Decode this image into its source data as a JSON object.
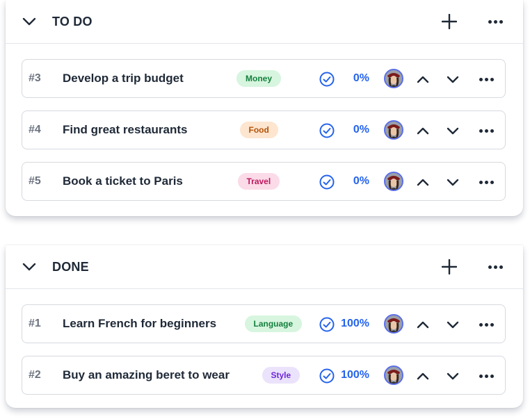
{
  "todo_group": {
    "title": "TO DO",
    "tasks": [
      {
        "id": "#3",
        "title": "Develop a trip budget",
        "tag": "Money",
        "tag_bg": "#d7f5df",
        "tag_fg": "#15803d",
        "progress": "0%"
      },
      {
        "id": "#4",
        "title": "Find great restaurants",
        "tag": "Food",
        "tag_bg": "#fde5cf",
        "tag_fg": "#b45309",
        "progress": "0%"
      },
      {
        "id": "#5",
        "title": "Book a ticket to Paris",
        "tag": "Travel",
        "tag_bg": "#fbdbe8",
        "tag_fg": "#be185d",
        "progress": "0%"
      }
    ]
  },
  "done_group": {
    "title": "DONE",
    "tasks": [
      {
        "id": "#1",
        "title": "Learn French for beginners",
        "tag": "Language",
        "tag_bg": "#d7f5df",
        "tag_fg": "#15803d",
        "progress": "100%"
      },
      {
        "id": "#2",
        "title": "Buy an amazing beret to wear",
        "tag": "Style",
        "tag_bg": "#ebe2fb",
        "tag_fg": "#6d28d9",
        "progress": "100%"
      }
    ]
  },
  "icons": {
    "collapse": "chevron-down-icon",
    "add": "plus-icon",
    "more": "more-horizontal-icon",
    "complete": "check-circle-icon",
    "move_up": "chevron-up-icon",
    "move_down": "chevron-down-icon"
  },
  "colors": {
    "accent": "#2563eb",
    "text": "#1f2937",
    "muted": "#6b7280",
    "border": "#d6d9df"
  }
}
